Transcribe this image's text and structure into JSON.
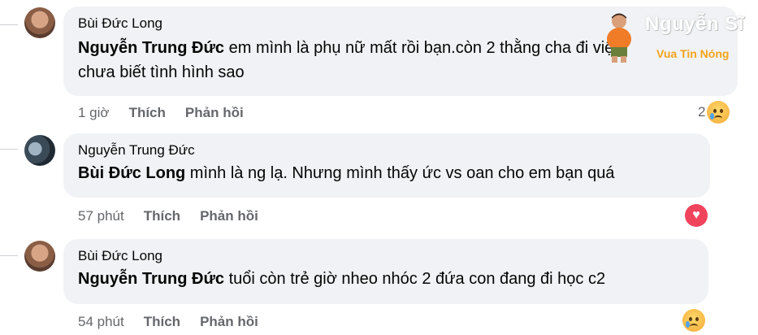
{
  "comments": [
    {
      "author": "Bùi Đức Long",
      "mention": "Nguyễn Trung Đức",
      "text_line1": " em mình là phụ nữ mất rồi bạn.còn 2 thằng cha đi viện",
      "text_line2": "chưa biết tình hình sao",
      "time": "1 giờ",
      "like": "Thích",
      "reply": "Phản hồi",
      "reaction_count": "2",
      "reaction_icon": "sad-emoji-icon"
    },
    {
      "author": "Nguyễn Trung Đức",
      "mention": "Bùi Đức Long",
      "text_line1": " mình là ng lạ. Nhưng mình thấy ức vs oan cho em bạn quá",
      "time": "57 phút",
      "like": "Thích",
      "reply": "Phản hồi",
      "reaction_icon": "heart-icon"
    },
    {
      "author": "Bùi Đức Long",
      "mention": "Nguyễn Trung Đức",
      "text_line1": " tuổi còn trẻ giờ nheo nhóc 2 đứa con đang đi học c2",
      "time": "54 phút",
      "like": "Thích",
      "reply": "Phản hồi",
      "reaction_icon": "sad-emoji-icon"
    }
  ],
  "watermark": {
    "title": "Nguyễn Sĩ",
    "subtitle": "Vua Tin Nóng"
  }
}
